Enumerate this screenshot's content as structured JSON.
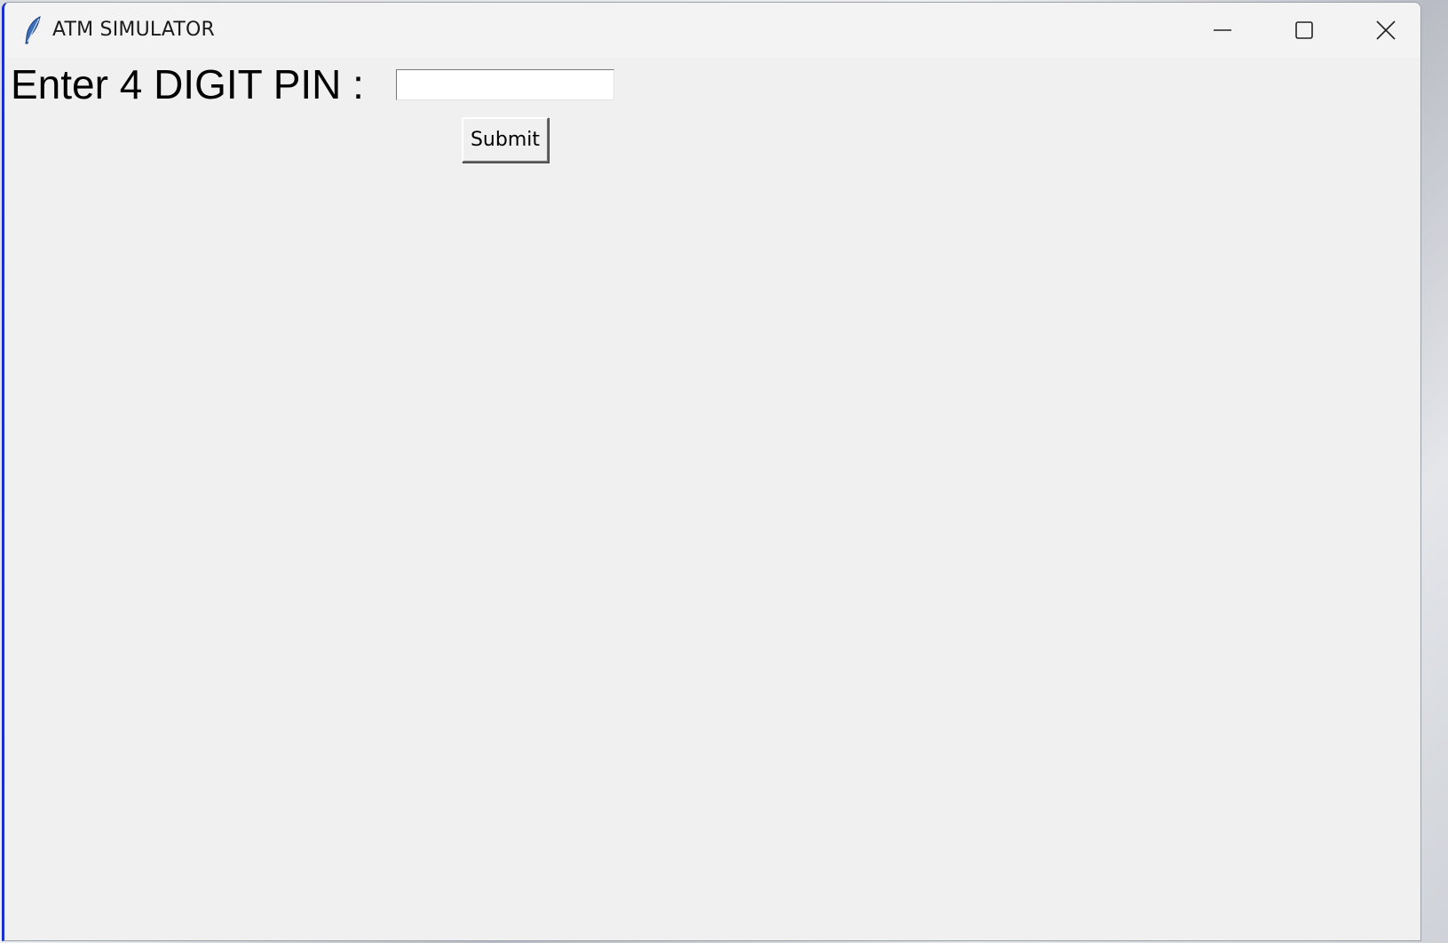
{
  "window": {
    "title": "ATM SIMULATOR",
    "app_icon": "feather-icon",
    "controls": {
      "minimize_icon": "minimize-icon",
      "maximize_icon": "maximize-icon",
      "close_icon": "close-icon"
    }
  },
  "form": {
    "pin_label": "Enter 4 DIGIT PIN :",
    "pin_value": "",
    "submit_label": "Submit"
  },
  "colors": {
    "window_background": "#f0f0f0",
    "titlebar_background": "#f3f3f3",
    "active_border": "#1a2fd0"
  }
}
